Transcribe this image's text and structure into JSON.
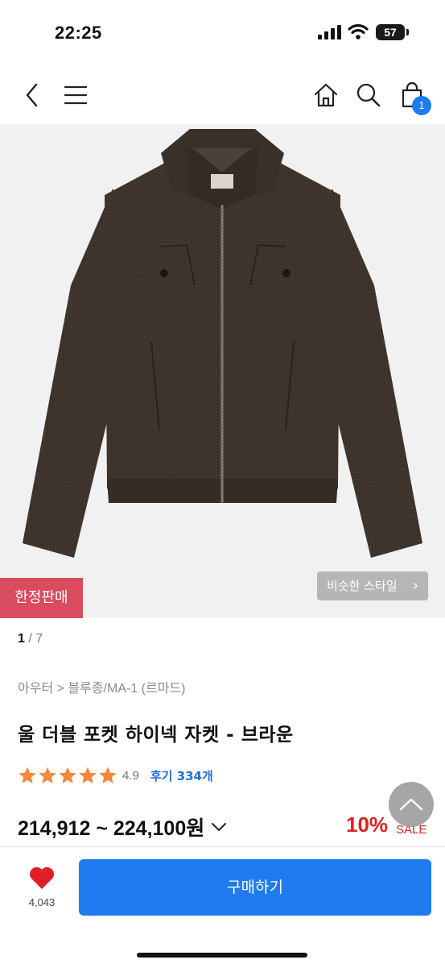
{
  "status_bar": {
    "time": "22:25",
    "battery": "57",
    "battery_level": 0.57
  },
  "nav": {
    "cart_count": "1"
  },
  "gallery": {
    "current": "1",
    "separator": "/",
    "total": "7",
    "limited_badge": "한정판매",
    "similar_style": "비슷한 스타일",
    "similar_chevron": "›"
  },
  "product": {
    "breadcrumb": "아우터 > 블루종/MA-1 (르마드)",
    "title": "울 더블 포켓 하이넥 자켓 - 브라운",
    "rating": "4.9",
    "stars": 5,
    "review_label": "후기 334개",
    "price_range": "214,912 ~ 224,100원",
    "discount": "10%",
    "sale_label": "SALE"
  },
  "bottom_bar": {
    "like_count": "4,043",
    "buy_label": "구매하기"
  },
  "colors": {
    "accent_blue": "#1e7bf0",
    "sale_red": "#e02020",
    "star_orange": "#f5883a",
    "badge_pink": "#d94b5e"
  },
  "icons": [
    "back-icon",
    "menu-icon",
    "home-icon",
    "search-icon",
    "cart-icon",
    "chevron-right-icon",
    "star-icon",
    "chevron-down-icon",
    "arrow-up-icon",
    "heart-icon"
  ]
}
